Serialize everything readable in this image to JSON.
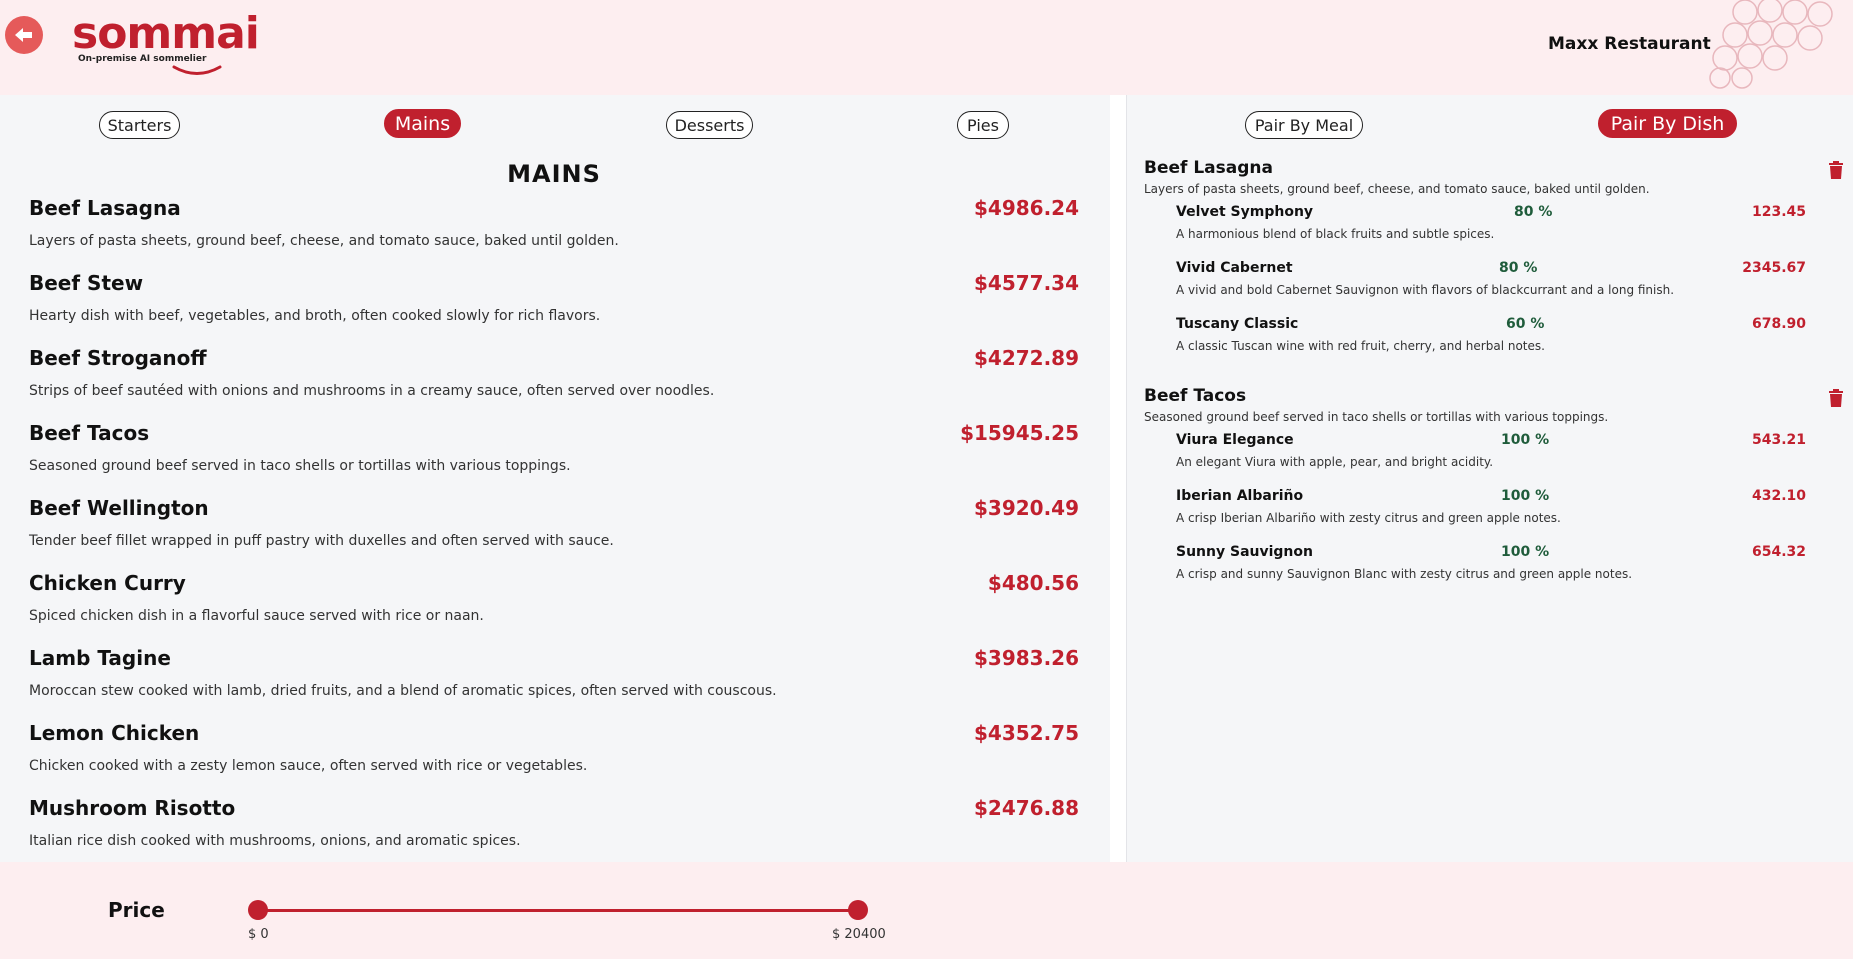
{
  "header": {
    "logo_word": "sommai",
    "logo_tagline": "On-premise AI sommelier",
    "restaurant": "Maxx Restaurant",
    "back_icon": "arrow-left-icon"
  },
  "categories": [
    {
      "label": "Starters",
      "active": false
    },
    {
      "label": "Mains",
      "active": true
    },
    {
      "label": "Desserts",
      "active": false
    },
    {
      "label": "Pies",
      "active": false
    }
  ],
  "section_title": "MAINS",
  "menu_items": [
    {
      "name": "Beef Lasagna",
      "price": "$4986.24",
      "desc": "Layers of pasta sheets, ground beef, cheese, and tomato sauce, baked until golden."
    },
    {
      "name": "Beef Stew",
      "price": "$4577.34",
      "desc": "Hearty dish with beef, vegetables, and broth, often cooked slowly for rich flavors."
    },
    {
      "name": "Beef Stroganoff",
      "price": "$4272.89",
      "desc": "Strips of beef sautéed with onions and mushrooms in a creamy sauce, often served over noodles."
    },
    {
      "name": "Beef Tacos",
      "price": "$15945.25",
      "desc": "Seasoned ground beef served in taco shells or tortillas with various toppings."
    },
    {
      "name": "Beef Wellington",
      "price": "$3920.49",
      "desc": "Tender beef fillet wrapped in puff pastry with duxelles and often served with sauce."
    },
    {
      "name": "Chicken Curry",
      "price": "$480.56",
      "desc": "Spiced chicken dish in a flavorful sauce served with rice or naan."
    },
    {
      "name": "Lamb Tagine",
      "price": "$3983.26",
      "desc": "Moroccan stew cooked with lamb, dried fruits, and a blend of aromatic spices, often served with couscous."
    },
    {
      "name": "Lemon Chicken",
      "price": "$4352.75",
      "desc": "Chicken cooked with a zesty lemon sauce, often served with rice or vegetables."
    },
    {
      "name": "Mushroom Risotto",
      "price": "$2476.88",
      "desc": "Italian rice dish cooked with mushrooms, onions, and aromatic spices."
    }
  ],
  "pair_tabs": [
    {
      "label": "Pair By Meal",
      "active": false
    },
    {
      "label": "Pair By Dish",
      "active": true
    }
  ],
  "pairings": [
    {
      "dish": "Beef Lasagna",
      "desc": "Layers of pasta sheets, ground beef, cheese, and tomato sauce, baked until golden.",
      "wines": [
        {
          "name": "Velvet Symphony",
          "pct": "80 %",
          "price": "123.45",
          "desc": "A harmonious blend of black fruits and subtle spices."
        },
        {
          "name": "Vivid Cabernet",
          "pct": "80 %",
          "price": "2345.67",
          "desc": "A vivid and bold Cabernet Sauvignon with flavors of blackcurrant and a long finish."
        },
        {
          "name": "Tuscany Classic",
          "pct": "60 %",
          "price": "678.90",
          "desc": "A classic Tuscan wine with red fruit, cherry, and herbal notes."
        }
      ]
    },
    {
      "dish": "Beef Tacos",
      "desc": "Seasoned ground beef served in taco shells or tortillas with various toppings.",
      "wines": [
        {
          "name": "Viura Elegance",
          "pct": "100 %",
          "price": "543.21",
          "desc": "An elegant Viura with apple, pear, and bright acidity."
        },
        {
          "name": "Iberian Albariño",
          "pct": "100 %",
          "price": "432.10",
          "desc": "A crisp Iberian Albariño with zesty citrus and green apple notes."
        },
        {
          "name": "Sunny Sauvignon",
          "pct": "100 %",
          "price": "654.32",
          "desc": "A crisp and sunny Sauvignon Blanc with zesty citrus and green apple notes."
        }
      ]
    }
  ],
  "price_filter": {
    "label": "Price",
    "min_label": "$ 0",
    "max_label": "$ 20400",
    "min_value": 0,
    "max_value": 20400
  },
  "colors": {
    "brand": "#c0202e",
    "match_green": "#1f5c3b",
    "header_bg": "#fdeef0"
  }
}
